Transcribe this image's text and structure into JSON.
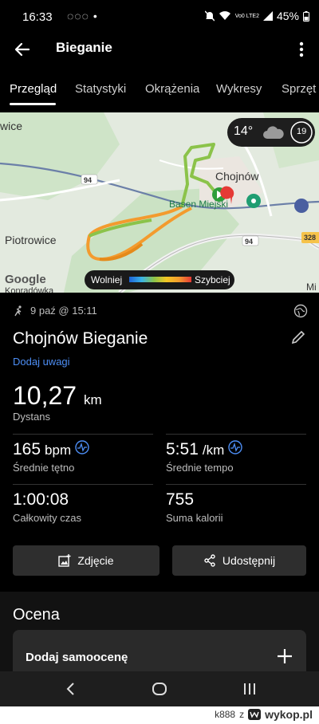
{
  "status_bar": {
    "time": "16:33",
    "notifications": "◌◌◌ •",
    "network": "Vo0 LTE2",
    "battery": "45%"
  },
  "app_bar": {
    "title": "Bieganie"
  },
  "tabs": [
    {
      "label": "Przegląd",
      "active": true
    },
    {
      "label": "Statystyki"
    },
    {
      "label": "Okrążenia"
    },
    {
      "label": "Wykresy"
    },
    {
      "label": "Sprzęt"
    }
  ],
  "map": {
    "labels": {
      "wice": "wice",
      "chojnow": "Chojnów",
      "basen": "Basen Miejski",
      "piotrowice": "Piotrowice",
      "google": "Google",
      "konradowka": "Konradówka",
      "mi": "Mi",
      "road_94a": "94",
      "road_94b": "94",
      "road_328": "328"
    },
    "weather": {
      "temp": "14°",
      "aqi": "19"
    },
    "legend": {
      "slow": "Wolniej",
      "fast": "Szybciej"
    },
    "colors": {
      "slow": "#1e63d6",
      "fast": "#e53935",
      "route_mid": "#8bc34a"
    }
  },
  "activity": {
    "date": "9 paź @ 15:11",
    "title": "Chojnów Bieganie",
    "add_note": "Dodaj uwagi",
    "distance": {
      "value": "10,27",
      "unit": "km",
      "label": "Dystans"
    },
    "heart_rate": {
      "value": "165",
      "unit": "bpm",
      "label": "Średnie tętno"
    },
    "pace": {
      "value": "5:51",
      "unit": "/km",
      "label": "Średnie tempo"
    },
    "total_time": {
      "value": "1:00:08",
      "label": "Całkowity czas"
    },
    "calories": {
      "value": "755",
      "label": "Suma kalorii"
    }
  },
  "buttons": {
    "photo": "Zdjęcie",
    "share": "Udostępnij"
  },
  "rating": {
    "title": "Ocena",
    "add_self": "Dodaj samoocenę"
  },
  "footer": {
    "user": "k888",
    "sep": "z",
    "site": "wykop.pl"
  },
  "accent": "#4d8ef5"
}
